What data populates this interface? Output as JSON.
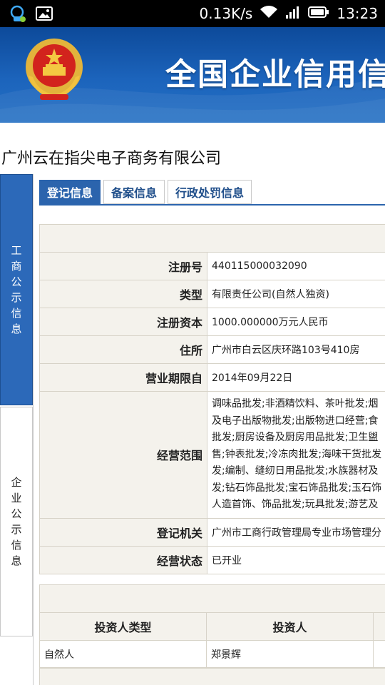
{
  "status_bar": {
    "speed": "0.13K/s",
    "time": "13:23",
    "icons": [
      "notification-app-icon",
      "image-icon",
      "wifi-icon",
      "signal-icon",
      "battery-icon"
    ]
  },
  "banner": {
    "title": "全国企业信用信",
    "emblem": "national-emblem-icon",
    "bg_color": "#1c64bc"
  },
  "company_name": "广州云在指尖电子商务有限公司",
  "sidebar": {
    "items": [
      {
        "label": "工商公示信息",
        "chars": [
          "工",
          "商",
          "公",
          "示",
          "信",
          "息"
        ],
        "active": true
      },
      {
        "label": "企业公示信息",
        "chars": [
          "企",
          "业",
          "公",
          "示",
          "信",
          "息"
        ],
        "active": false
      }
    ]
  },
  "tabs": [
    {
      "label": "登记信息",
      "active": true
    },
    {
      "label": "备案信息",
      "active": false
    },
    {
      "label": "行政处罚信息",
      "active": false
    }
  ],
  "registration": {
    "rows": [
      {
        "label": "注册号",
        "value": "440115000032090"
      },
      {
        "label": "类型",
        "value": "有限责任公司(自然人独资)"
      },
      {
        "label": "注册资本",
        "value": "1000.000000万元人民币"
      },
      {
        "label": "住所",
        "value": "广州市白云区庆环路103号410房"
      },
      {
        "label": "营业期限自",
        "value": "2014年09月22日"
      }
    ],
    "scope_label": "经营范围",
    "scope_lines": [
      "调味品批发;非酒精饮料、茶叶批发;烟",
      "及电子出版物批发;出版物进口经营;食",
      "批发;厨房设备及厨房用品批发;卫生盥",
      "售;钟表批发;冷冻肉批发;海味干货批发",
      "发;编制、缝纫日用品批发;水族器材及",
      "发;钻石饰品批发;宝石饰品批发;玉石饰",
      "人造首饰、饰品批发;玩具批发;游艺及"
    ],
    "rows_after": [
      {
        "label": "登记机关",
        "value": "广州市工商行政管理局专业市场管理分"
      },
      {
        "label": "经营状态",
        "value": "已开业"
      }
    ]
  },
  "investors": {
    "headers": [
      "投资人类型",
      "投资人"
    ],
    "rows": [
      {
        "type": "自然人",
        "name": "郑景辉"
      }
    ]
  },
  "colors": {
    "accent": "#2b64ad",
    "label_bg": "#f4f2ec",
    "border": "#d7d3c8"
  }
}
